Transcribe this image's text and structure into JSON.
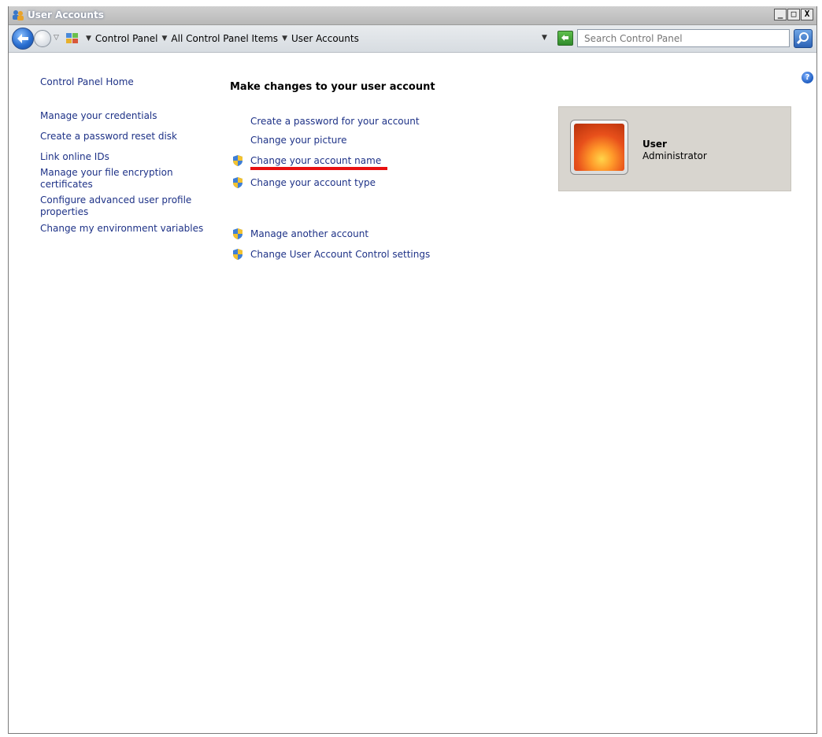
{
  "window": {
    "title": "User Accounts",
    "controls": {
      "minimize": "_",
      "maximize": "□",
      "close": "X"
    }
  },
  "navbar": {
    "breadcrumbs": [
      "Control Panel",
      "All Control Panel Items",
      "User Accounts"
    ],
    "search_placeholder": "Search Control Panel"
  },
  "sidebar": {
    "items": [
      "Control Panel Home",
      "Manage your credentials",
      "Create a password reset disk",
      "Link online IDs",
      "Manage your file encryption certificates",
      "Configure advanced user profile properties",
      "Change my environment variables"
    ]
  },
  "main": {
    "title": "Make changes to your user account",
    "tasks": [
      {
        "label": "Create a password for your account",
        "icon": "none"
      },
      {
        "label": "Change your picture",
        "icon": "none"
      },
      {
        "label": "Change your account name",
        "icon": "uac-shield-icon"
      },
      {
        "label": "Change your account type",
        "icon": "uac-shield-icon"
      },
      {
        "label": "Manage another account",
        "icon": "uac-shield-icon"
      },
      {
        "label": "Change User Account Control settings",
        "icon": "uac-shield-icon"
      }
    ]
  },
  "account": {
    "name": "User",
    "role": "Administrator"
  },
  "colors": {
    "link": "#1e3287",
    "highlight_underline": "#e81010",
    "account_card_bg": "#d8d5cf"
  }
}
